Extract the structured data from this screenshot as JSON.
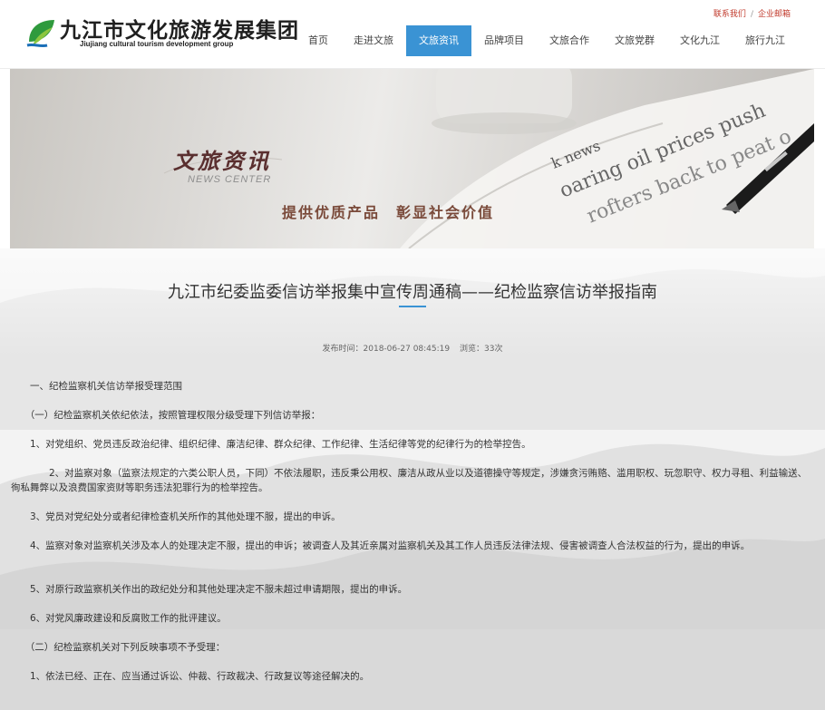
{
  "header": {
    "logo_cn": "九江市文化旅游发展集团",
    "logo_en": "Jiujiang cultural tourism development group",
    "top_links": [
      "联系我们",
      "企业邮箱"
    ],
    "top_link_separator": "/",
    "nav": [
      {
        "label": "首页",
        "active": false
      },
      {
        "label": "走进文旅",
        "active": false
      },
      {
        "label": "文旅资讯",
        "active": true
      },
      {
        "label": "品牌项目",
        "active": false
      },
      {
        "label": "文旅合作",
        "active": false
      },
      {
        "label": "文旅党群",
        "active": false
      },
      {
        "label": "文化九江",
        "active": false
      },
      {
        "label": "旅行九江",
        "active": false
      }
    ],
    "accent_color": "#3a93d4"
  },
  "banner": {
    "title": "文旅资讯",
    "subtitle": "NEWS CENTER",
    "slogan": "提供优质产品　彰显社会价值",
    "newspaper_text": [
      "k news",
      "oaring oil prices push",
      "rofters back to peat o"
    ]
  },
  "article": {
    "title": "九江市纪委监委信访举报集中宣传周通稿——纪检监察信访举报指南",
    "publish_time_label": "发布时间：2018-06-27 08:45:19",
    "views_label": "浏览：33次",
    "paragraphs": [
      "　　一、纪检监察机关信访举报受理范围",
      "　　（一）纪检监察机关依纪依法，按照管理权限分级受理下列信访举报：",
      "　　1、对党组织、党员违反政治纪律、组织纪律、廉洁纪律、群众纪律、工作纪律、生活纪律等党的纪律行为的检举控告。",
      "　　　　2、对监察对象（监察法规定的六类公职人员，下同）不依法履职，违反秉公用权、廉洁从政从业以及道德操守等规定，涉嫌贪污贿赂、滥用职权、玩忽职守、权力寻租、利益输送、徇私舞弊以及浪费国家资财等职务违法犯罪行为的检举控告。",
      "　　3、党员对党纪处分或者纪律检查机关所作的其他处理不服，提出的申诉。",
      "　　4、监察对象对监察机关涉及本人的处理决定不服，提出的申诉；被调查人及其近亲属对监察机关及其工作人员违反法律法规、侵害被调查人合法权益的行为，提出的申诉。",
      "　　5、对原行政监察机关作出的政纪处分和其他处理决定不服未超过申请期限，提出的申诉。",
      "　　6、对党风廉政建设和反腐败工作的批评建议。",
      "　　（二）纪检监察机关对下列反映事项不予受理：",
      "　　1、依法已经、正在、应当通过诉讼、仲裁、行政裁决、行政复议等途径解决的。"
    ]
  }
}
